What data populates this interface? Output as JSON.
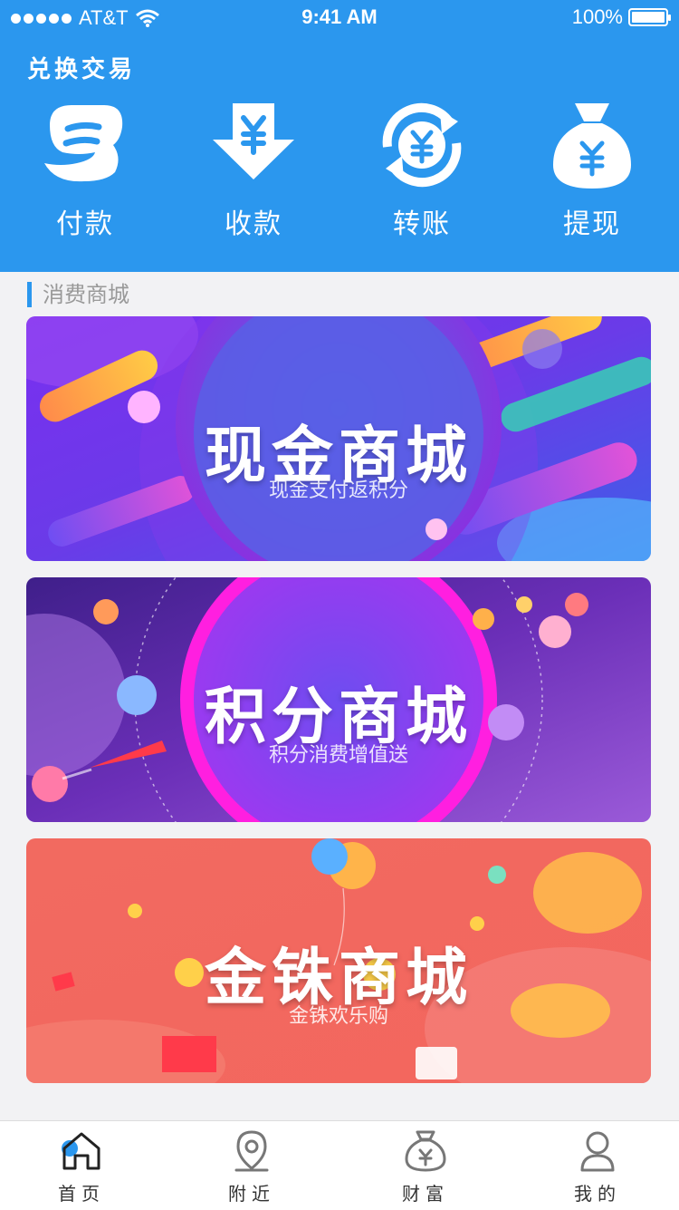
{
  "status": {
    "carrier": "AT&T",
    "time": "9:41 AM",
    "battery": "100%"
  },
  "header": {
    "title": "兑换交易"
  },
  "actions": [
    {
      "label": "付款",
      "icon": "pay-icon"
    },
    {
      "label": "收款",
      "icon": "receive-icon"
    },
    {
      "label": "转账",
      "icon": "transfer-icon"
    },
    {
      "label": "提现",
      "icon": "withdraw-icon"
    }
  ],
  "section": {
    "title": "消费商城"
  },
  "banners": [
    {
      "title": "现金商城",
      "subtitle": "现金支付返积分"
    },
    {
      "title": "积分商城",
      "subtitle": "积分消费增值送"
    },
    {
      "title": "金铢商城",
      "subtitle": "金铢欢乐购"
    }
  ],
  "tabbar": [
    {
      "label": "首页",
      "icon": "home-icon",
      "active": true
    },
    {
      "label": "附近",
      "icon": "location-icon"
    },
    {
      "label": "财富",
      "icon": "money-bag-icon"
    },
    {
      "label": "我的",
      "icon": "user-icon"
    }
  ],
  "colors": {
    "primary": "#2b97ee"
  }
}
